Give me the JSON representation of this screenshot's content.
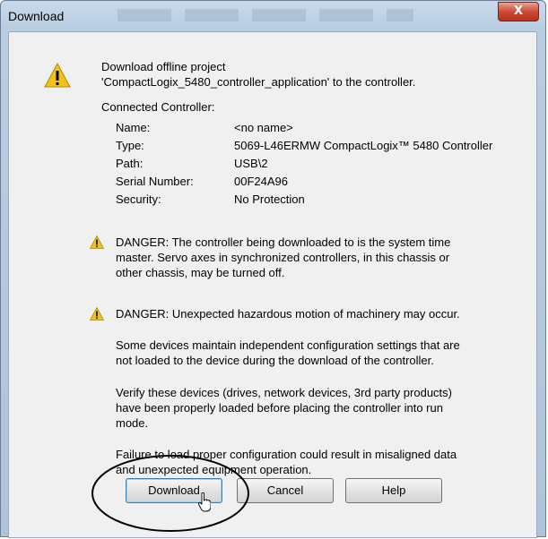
{
  "window": {
    "title": "Download",
    "close_label": "X"
  },
  "intro": {
    "line1": "Download offline project",
    "line2": "'CompactLogix_5480_controller_application' to the controller."
  },
  "connected": {
    "title": "Connected Controller:",
    "rows": [
      {
        "label": "Name:",
        "value": "<no name>"
      },
      {
        "label": "Type:",
        "value": "5069-L46ERMW CompactLogix™ 5480 Controller"
      },
      {
        "label": "Path:",
        "value": "USB\\2"
      },
      {
        "label": "Serial Number:",
        "value": "00F24A96"
      },
      {
        "label": "Security:",
        "value": "No Protection"
      }
    ]
  },
  "danger1": {
    "line1": "DANGER: The controller being downloaded to is the system time",
    "line2": "master.  Servo axes in synchronized controllers, in this chassis or",
    "line3": "other chassis, may be turned off."
  },
  "danger2": {
    "line1": "DANGER: Unexpected hazardous motion of machinery may occur."
  },
  "para1": {
    "line1": "Some devices maintain independent configuration settings that are",
    "line2": "not loaded to the device during the download of the controller."
  },
  "para2": {
    "line1": "Verify these devices (drives, network devices, 3rd party products)",
    "line2": "have been properly loaded before placing the controller into run",
    "line3": "mode."
  },
  "para3": {
    "line1": "Failure to load proper configuration could result in misaligned data",
    "line2": "and unexpected equipment operation."
  },
  "buttons": {
    "download": "Download",
    "cancel": "Cancel",
    "help": "Help"
  },
  "colors": {
    "warning_yellow": "#f2c21b",
    "window_frame": "#b9cde2",
    "highlight_oval": "#000000"
  }
}
